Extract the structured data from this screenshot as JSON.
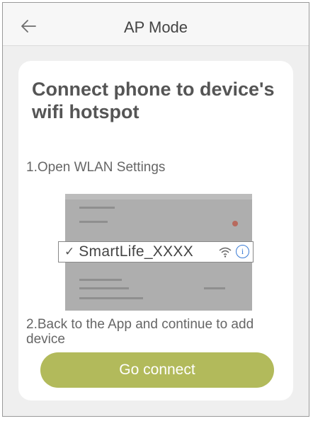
{
  "header": {
    "title": "AP Mode",
    "back_icon": "arrow-left-icon"
  },
  "card": {
    "heading": "Connect phone to device's wifi hotspot",
    "step1": "1.Open WLAN Settings",
    "illustration": {
      "network_name": "SmartLife_XXXX",
      "check_icon": "checkmark-icon",
      "wifi_icon": "wifi-signal-icon",
      "info_icon": "info-icon",
      "info_glyph": "i"
    },
    "step2": "2.Back to the App and continue to add device",
    "button_label": "Go connect",
    "button_color": "#b2ba5b"
  }
}
